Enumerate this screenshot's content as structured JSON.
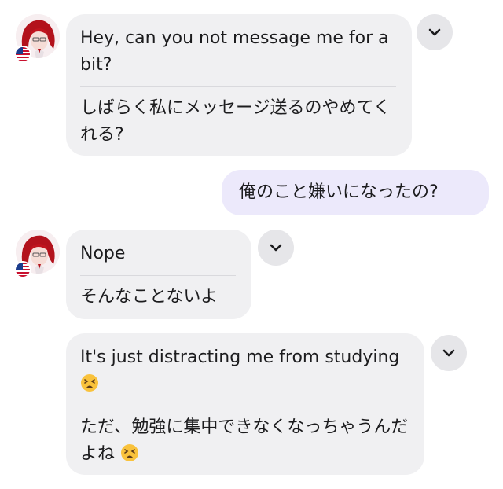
{
  "messages": [
    {
      "original": "Hey, can you not message me for a bit?",
      "translation": "しばらく私にメッセージ送るのやめてくれる?"
    },
    {
      "text": "俺のこと嫌いになったの?"
    },
    {
      "original": "Nope",
      "translation": "そんなことないよ"
    },
    {
      "original": "It's just distracting me from studying",
      "translation": "ただ、勉強に集中できなくなっちゃうんだよね"
    }
  ],
  "icons": {
    "menu": "chevron-down-icon",
    "emoji": "tired-face-emoji",
    "flag": "us-flag-icon"
  },
  "colors": {
    "incoming_bubble": "#f0f0f2",
    "outgoing_bubble": "#ece9fb",
    "menu_button": "#e6e6e9"
  }
}
